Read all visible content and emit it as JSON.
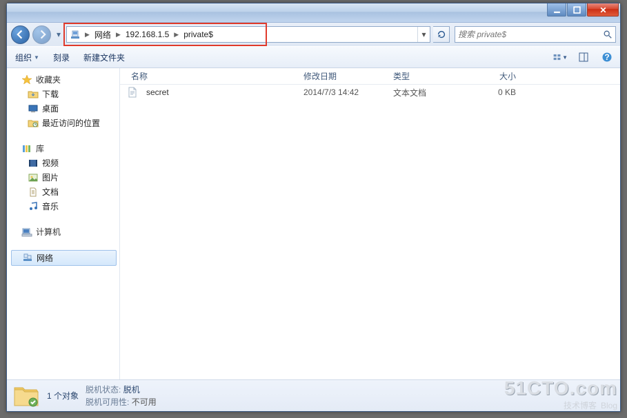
{
  "window": {
    "min_tooltip": "最小化",
    "max_tooltip": "最大化",
    "close_tooltip": "关闭"
  },
  "address": {
    "crumbs": [
      "网络",
      "192.168.1.5",
      "private$"
    ],
    "refresh_tooltip": "刷新"
  },
  "search": {
    "placeholder": "搜索 private$"
  },
  "toolbar": {
    "organize": "组织",
    "burn": "刻录",
    "newfolder": "新建文件夹",
    "view_tooltip": "更改视图",
    "preview_tooltip": "显示预览窗格",
    "help_tooltip": "获取帮助"
  },
  "sidebar": {
    "favorites": {
      "label": "收藏夹",
      "items": [
        {
          "label": "下载"
        },
        {
          "label": "桌面"
        },
        {
          "label": "最近访问的位置"
        }
      ]
    },
    "libraries": {
      "label": "库",
      "items": [
        {
          "label": "视频"
        },
        {
          "label": "图片"
        },
        {
          "label": "文档"
        },
        {
          "label": "音乐"
        }
      ]
    },
    "computer": {
      "label": "计算机"
    },
    "network": {
      "label": "网络"
    }
  },
  "columns": {
    "name": "名称",
    "date": "修改日期",
    "type": "类型",
    "size": "大小"
  },
  "files": [
    {
      "name": "secret",
      "date": "2014/7/3 14:42",
      "type": "文本文档",
      "size": "0 KB"
    }
  ],
  "status": {
    "count": "1 个对象",
    "offline_label": "脱机状态:",
    "offline_value": "脱机",
    "avail_label": "脱机可用性:",
    "avail_value": "不可用"
  },
  "watermark": {
    "line1": "51CTO.com",
    "line2": "技术博客",
    "line2b": "Blog"
  }
}
